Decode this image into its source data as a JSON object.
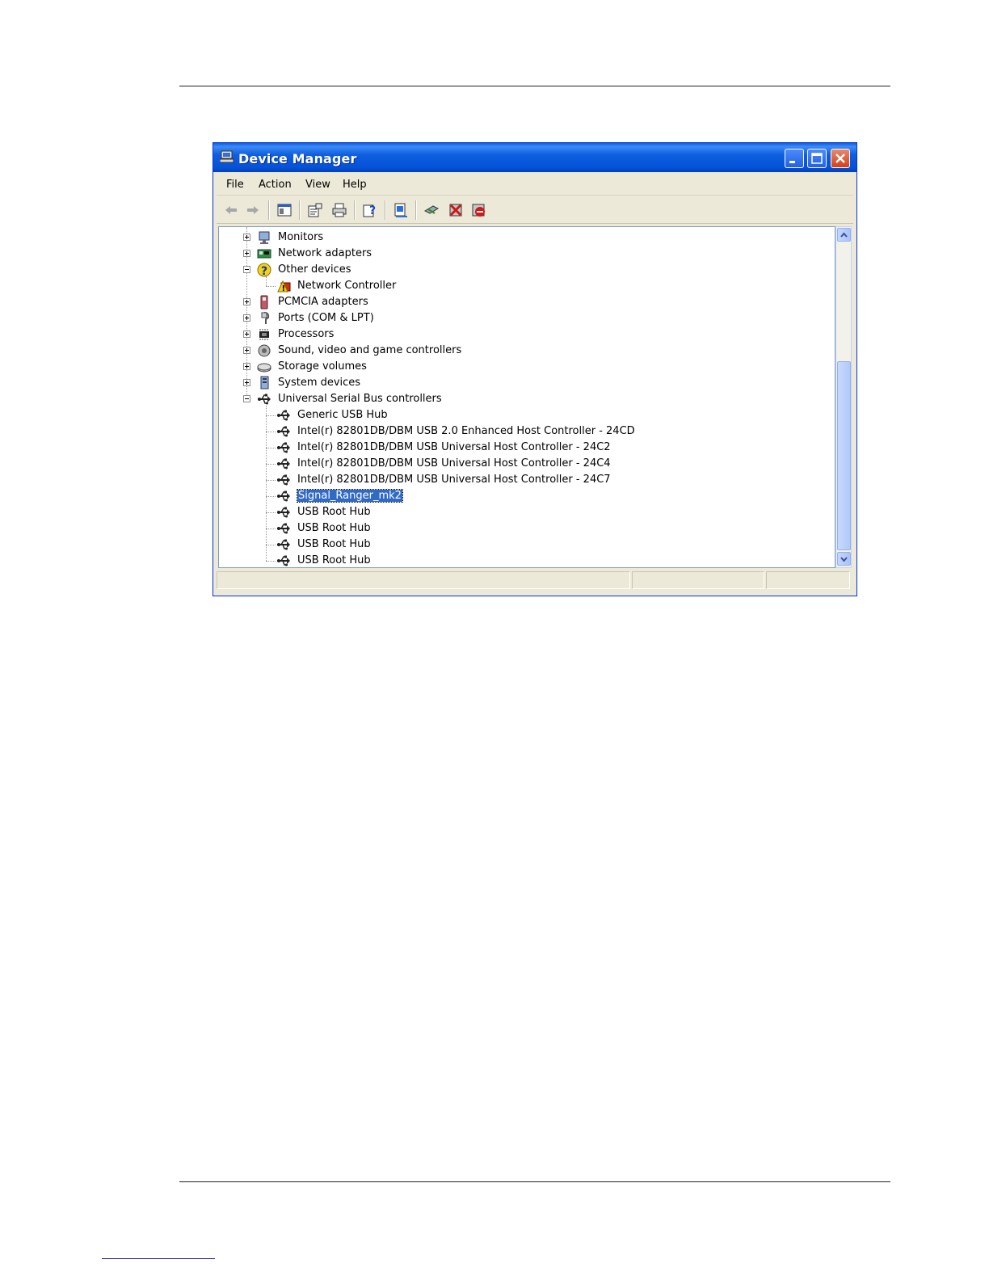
{
  "window": {
    "title": "Device Manager",
    "icon": "computer-icon",
    "colors": {
      "titlebar": "#0452d8",
      "selection": "#316ac5",
      "close": "#d2401c"
    }
  },
  "menu": [
    "File",
    "Action",
    "View",
    "Help"
  ],
  "toolbar": [
    "back-icon",
    "forward-icon",
    "show-hide-tree-icon",
    "properties-icon",
    "print-icon",
    "help-icon",
    "update-driver-icon",
    "scan-hardware-icon",
    "uninstall-icon",
    "disable-icon"
  ],
  "tree": {
    "items": [
      {
        "label": "Monitors",
        "icon": "monitor-icon",
        "expander": "plus"
      },
      {
        "label": "Network adapters",
        "icon": "network-card-icon",
        "expander": "plus"
      },
      {
        "label": "Other devices",
        "icon": "unknown-device-icon",
        "expander": "minus"
      },
      {
        "label": "Network Controller",
        "icon": "warning-device-icon"
      },
      {
        "label": "PCMCIA adapters",
        "icon": "pcmcia-icon",
        "expander": "plus"
      },
      {
        "label": "Ports (COM & LPT)",
        "icon": "port-icon",
        "expander": "plus"
      },
      {
        "label": "Processors",
        "icon": "processor-icon",
        "expander": "plus"
      },
      {
        "label": "Sound, video and game controllers",
        "icon": "sound-icon",
        "expander": "plus"
      },
      {
        "label": "Storage volumes",
        "icon": "storage-icon",
        "expander": "plus"
      },
      {
        "label": "System devices",
        "icon": "system-icon",
        "expander": "plus"
      },
      {
        "label": "Universal Serial Bus controllers",
        "icon": "usb-icon",
        "expander": "minus"
      },
      {
        "label": "Generic USB Hub",
        "icon": "usb-icon"
      },
      {
        "label": "Intel(r) 82801DB/DBM USB 2.0 Enhanced Host Controller - 24CD",
        "icon": "usb-icon"
      },
      {
        "label": "Intel(r) 82801DB/DBM USB Universal Host Controller - 24C2",
        "icon": "usb-icon"
      },
      {
        "label": "Intel(r) 82801DB/DBM USB Universal Host Controller - 24C4",
        "icon": "usb-icon"
      },
      {
        "label": "Intel(r) 82801DB/DBM USB Universal Host Controller - 24C7",
        "icon": "usb-icon"
      },
      {
        "label": "Signal_Ranger_mk2",
        "icon": "usb-icon",
        "selected": true
      },
      {
        "label": "USB Root Hub",
        "icon": "usb-icon"
      },
      {
        "label": "USB Root Hub",
        "icon": "usb-icon"
      },
      {
        "label": "USB Root Hub",
        "icon": "usb-icon"
      },
      {
        "label": "USB Root Hub",
        "icon": "usb-icon"
      }
    ]
  }
}
